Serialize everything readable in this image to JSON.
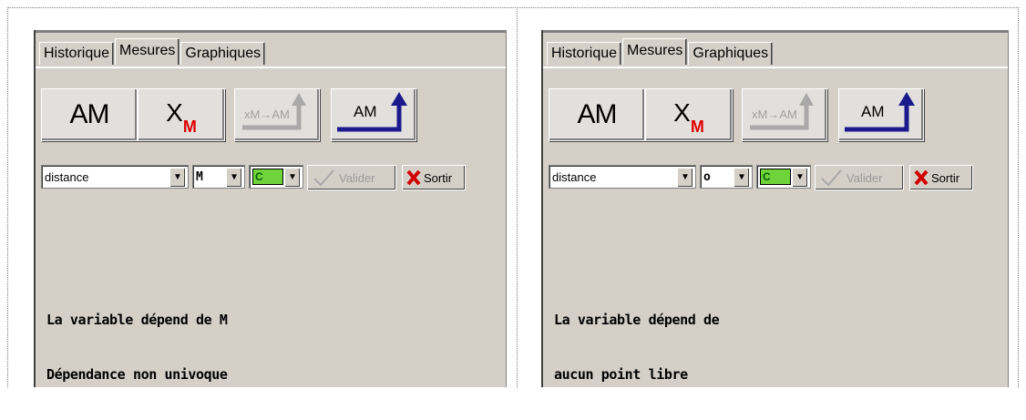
{
  "left": {
    "tabs": [
      "Historique",
      "Mesures",
      "Graphiques"
    ],
    "active_tab": "Mesures",
    "toolbar": {
      "am_label": "AM",
      "xm_main": "X",
      "xm_sub": "M",
      "convert_label": "xM→AM",
      "return_label": "AM"
    },
    "controls": {
      "variable_select": "distance",
      "point_select": "M",
      "color_select": "C",
      "validate_label": "Valider",
      "exit_label": "Sortir"
    },
    "message": {
      "line1": "La variable dépend de M",
      "line2": "Dépendance non univoque"
    }
  },
  "right": {
    "tabs": [
      "Historique",
      "Mesures",
      "Graphiques"
    ],
    "active_tab": "Mesures",
    "toolbar": {
      "am_label": "AM",
      "xm_main": "X",
      "xm_sub": "M",
      "convert_label": "xM→AM",
      "return_label": "AM"
    },
    "controls": {
      "variable_select": "distance",
      "point_select": "o",
      "color_select": "C",
      "validate_label": "Valider",
      "exit_label": "Sortir"
    },
    "message": {
      "line1": "La variable dépend de",
      "line2": "aucun point libre"
    }
  },
  "colors": {
    "panel_bg": "#d4d0c8",
    "accent_red": "#e00000",
    "arrow_blue": "#1a1a8c",
    "arrow_grey": "#a9a9a9",
    "swatch_green": "#6ed43a"
  }
}
